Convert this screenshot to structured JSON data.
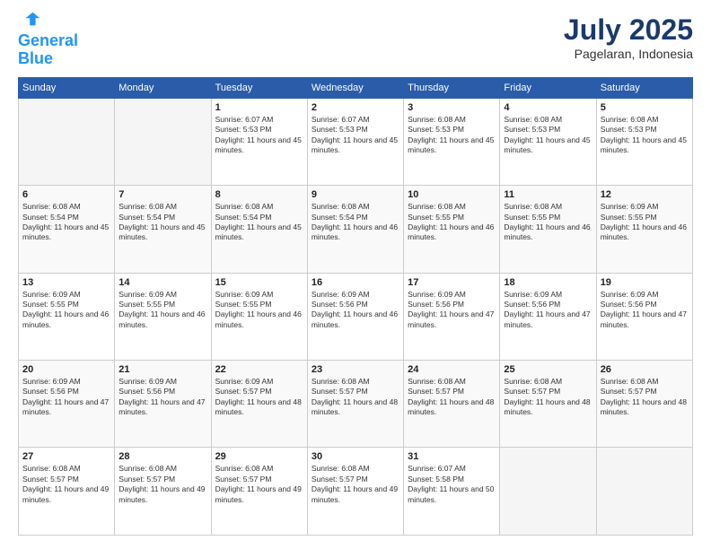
{
  "header": {
    "logo_line1": "General",
    "logo_line2": "Blue",
    "month_year": "July 2025",
    "location": "Pagelaran, Indonesia"
  },
  "days_of_week": [
    "Sunday",
    "Monday",
    "Tuesday",
    "Wednesday",
    "Thursday",
    "Friday",
    "Saturday"
  ],
  "weeks": [
    [
      {
        "day": "",
        "info": ""
      },
      {
        "day": "",
        "info": ""
      },
      {
        "day": "1",
        "info": "Sunrise: 6:07 AM\nSunset: 5:53 PM\nDaylight: 11 hours and 45 minutes."
      },
      {
        "day": "2",
        "info": "Sunrise: 6:07 AM\nSunset: 5:53 PM\nDaylight: 11 hours and 45 minutes."
      },
      {
        "day": "3",
        "info": "Sunrise: 6:08 AM\nSunset: 5:53 PM\nDaylight: 11 hours and 45 minutes."
      },
      {
        "day": "4",
        "info": "Sunrise: 6:08 AM\nSunset: 5:53 PM\nDaylight: 11 hours and 45 minutes."
      },
      {
        "day": "5",
        "info": "Sunrise: 6:08 AM\nSunset: 5:53 PM\nDaylight: 11 hours and 45 minutes."
      }
    ],
    [
      {
        "day": "6",
        "info": "Sunrise: 6:08 AM\nSunset: 5:54 PM\nDaylight: 11 hours and 45 minutes."
      },
      {
        "day": "7",
        "info": "Sunrise: 6:08 AM\nSunset: 5:54 PM\nDaylight: 11 hours and 45 minutes."
      },
      {
        "day": "8",
        "info": "Sunrise: 6:08 AM\nSunset: 5:54 PM\nDaylight: 11 hours and 45 minutes."
      },
      {
        "day": "9",
        "info": "Sunrise: 6:08 AM\nSunset: 5:54 PM\nDaylight: 11 hours and 46 minutes."
      },
      {
        "day": "10",
        "info": "Sunrise: 6:08 AM\nSunset: 5:55 PM\nDaylight: 11 hours and 46 minutes."
      },
      {
        "day": "11",
        "info": "Sunrise: 6:08 AM\nSunset: 5:55 PM\nDaylight: 11 hours and 46 minutes."
      },
      {
        "day": "12",
        "info": "Sunrise: 6:09 AM\nSunset: 5:55 PM\nDaylight: 11 hours and 46 minutes."
      }
    ],
    [
      {
        "day": "13",
        "info": "Sunrise: 6:09 AM\nSunset: 5:55 PM\nDaylight: 11 hours and 46 minutes."
      },
      {
        "day": "14",
        "info": "Sunrise: 6:09 AM\nSunset: 5:55 PM\nDaylight: 11 hours and 46 minutes."
      },
      {
        "day": "15",
        "info": "Sunrise: 6:09 AM\nSunset: 5:55 PM\nDaylight: 11 hours and 46 minutes."
      },
      {
        "day": "16",
        "info": "Sunrise: 6:09 AM\nSunset: 5:56 PM\nDaylight: 11 hours and 46 minutes."
      },
      {
        "day": "17",
        "info": "Sunrise: 6:09 AM\nSunset: 5:56 PM\nDaylight: 11 hours and 47 minutes."
      },
      {
        "day": "18",
        "info": "Sunrise: 6:09 AM\nSunset: 5:56 PM\nDaylight: 11 hours and 47 minutes."
      },
      {
        "day": "19",
        "info": "Sunrise: 6:09 AM\nSunset: 5:56 PM\nDaylight: 11 hours and 47 minutes."
      }
    ],
    [
      {
        "day": "20",
        "info": "Sunrise: 6:09 AM\nSunset: 5:56 PM\nDaylight: 11 hours and 47 minutes."
      },
      {
        "day": "21",
        "info": "Sunrise: 6:09 AM\nSunset: 5:56 PM\nDaylight: 11 hours and 47 minutes."
      },
      {
        "day": "22",
        "info": "Sunrise: 6:09 AM\nSunset: 5:57 PM\nDaylight: 11 hours and 48 minutes."
      },
      {
        "day": "23",
        "info": "Sunrise: 6:08 AM\nSunset: 5:57 PM\nDaylight: 11 hours and 48 minutes."
      },
      {
        "day": "24",
        "info": "Sunrise: 6:08 AM\nSunset: 5:57 PM\nDaylight: 11 hours and 48 minutes."
      },
      {
        "day": "25",
        "info": "Sunrise: 6:08 AM\nSunset: 5:57 PM\nDaylight: 11 hours and 48 minutes."
      },
      {
        "day": "26",
        "info": "Sunrise: 6:08 AM\nSunset: 5:57 PM\nDaylight: 11 hours and 48 minutes."
      }
    ],
    [
      {
        "day": "27",
        "info": "Sunrise: 6:08 AM\nSunset: 5:57 PM\nDaylight: 11 hours and 49 minutes."
      },
      {
        "day": "28",
        "info": "Sunrise: 6:08 AM\nSunset: 5:57 PM\nDaylight: 11 hours and 49 minutes."
      },
      {
        "day": "29",
        "info": "Sunrise: 6:08 AM\nSunset: 5:57 PM\nDaylight: 11 hours and 49 minutes."
      },
      {
        "day": "30",
        "info": "Sunrise: 6:08 AM\nSunset: 5:57 PM\nDaylight: 11 hours and 49 minutes."
      },
      {
        "day": "31",
        "info": "Sunrise: 6:07 AM\nSunset: 5:58 PM\nDaylight: 11 hours and 50 minutes."
      },
      {
        "day": "",
        "info": ""
      },
      {
        "day": "",
        "info": ""
      }
    ]
  ]
}
